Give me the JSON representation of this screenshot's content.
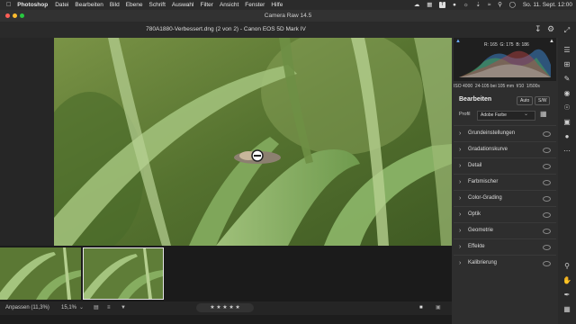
{
  "menubar": {
    "app": "Photoshop",
    "items": [
      "Datei",
      "Bearbeiten",
      "Bild",
      "Ebene",
      "Schrift",
      "Auswahl",
      "Filter",
      "Ansicht",
      "Fenster",
      "Hilfe"
    ],
    "datetime": "So. 11. Sept. 12:00",
    "status_square_label": "T"
  },
  "window": {
    "title": "Camera Raw 14.5"
  },
  "file": {
    "name": "780A1880-Verbessert.dng (2 von 2) - Canon EOS 5D Mark IV"
  },
  "histogram": {
    "r_label": "R:",
    "r": "165",
    "g_label": "G:",
    "g": "175",
    "b_label": "B:",
    "b": "186"
  },
  "camera": {
    "iso": "ISO 4000",
    "lens": "24-105 bei 105 mm",
    "aperture": "f/10",
    "shutter": "1/500s"
  },
  "edit": {
    "title": "Bearbeiten",
    "auto_label": "Auto",
    "bw_label": "S/W",
    "profile_label": "Profil",
    "profile_value": "Adobe Farbe"
  },
  "sections": [
    {
      "label": "Grundeinstellungen"
    },
    {
      "label": "Gradationskurve"
    },
    {
      "label": "Detail"
    },
    {
      "label": "Farbmischer"
    },
    {
      "label": "Color-Grading"
    },
    {
      "label": "Optik"
    },
    {
      "label": "Geometrie"
    },
    {
      "label": "Effekte"
    },
    {
      "label": "Kalibrierung"
    }
  ],
  "bottombar": {
    "fit_label": "Anpassen (11,3%)",
    "zoom_value": "15,1%",
    "rating_stars": 0
  },
  "colors": {
    "accent": "#1473e6",
    "panel": "#2e2e2e",
    "menubar": "#2b2b2b"
  }
}
